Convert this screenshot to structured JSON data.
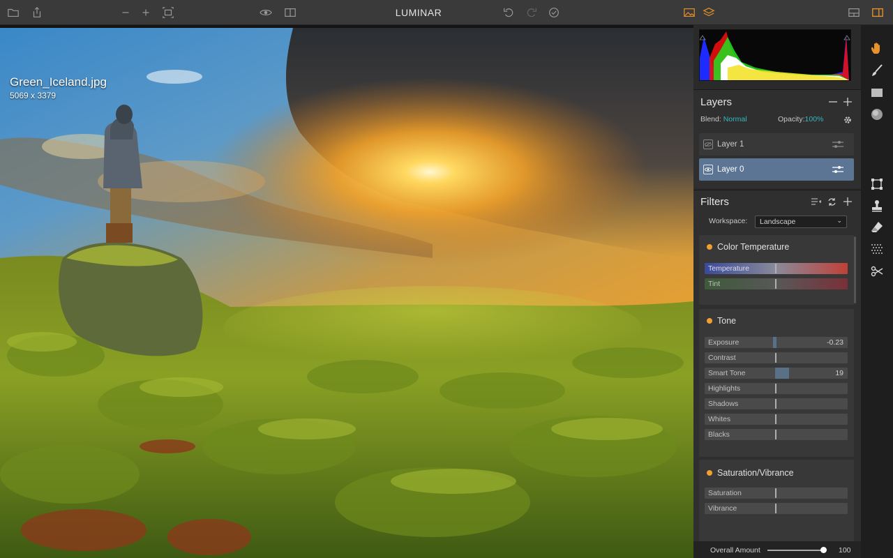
{
  "app": {
    "title": "LUMINAR"
  },
  "toolbar": {
    "icons": [
      "folder-icon",
      "share-icon",
      "zoom-out-icon",
      "zoom-in-icon",
      "fit-screen-icon",
      "eye-icon",
      "compare-icon",
      "undo-icon",
      "redo-icon",
      "done-icon",
      "image-view-icon",
      "layers-view-icon",
      "split-layout-icon",
      "panel-layout-icon"
    ],
    "accent": "#e8922a"
  },
  "image": {
    "filename": "Green_Iceland.jpg",
    "dimensions": "5069 x 3379"
  },
  "layers": {
    "title": "Layers",
    "blend_label": "Blend:",
    "blend_value": "Normal",
    "opacity_label": "Opacity:",
    "opacity_value": "100%",
    "items": [
      {
        "label": "Layer 1",
        "selected": false
      },
      {
        "label": "Layer 0",
        "selected": true
      }
    ]
  },
  "filters": {
    "title": "Filters",
    "workspace_label": "Workspace:",
    "workspace_value": "Landscape",
    "cards": [
      {
        "title": "Color Temperature",
        "sliders": [
          {
            "label": "Temperature",
            "value": ""
          },
          {
            "label": "Tint",
            "value": ""
          }
        ]
      },
      {
        "title": "Tone",
        "sliders": [
          {
            "label": "Exposure",
            "value": "-0.23"
          },
          {
            "label": "Contrast",
            "value": ""
          },
          {
            "label": "Smart Tone",
            "value": "19"
          },
          {
            "label": "Highlights",
            "value": ""
          },
          {
            "label": "Shadows",
            "value": ""
          },
          {
            "label": "Whites",
            "value": ""
          },
          {
            "label": "Blacks",
            "value": ""
          }
        ]
      },
      {
        "title": "Saturation/Vibrance",
        "sliders": [
          {
            "label": "Saturation",
            "value": ""
          },
          {
            "label": "Vibrance",
            "value": ""
          }
        ]
      }
    ]
  },
  "overall": {
    "label": "Overall Amount",
    "value": "100"
  },
  "tools": [
    "hand-icon",
    "brush-icon",
    "gradient-icon",
    "radial-icon",
    "crop-icon",
    "clone-stamp-icon",
    "eraser-icon",
    "texture-icon",
    "scissors-icon"
  ]
}
